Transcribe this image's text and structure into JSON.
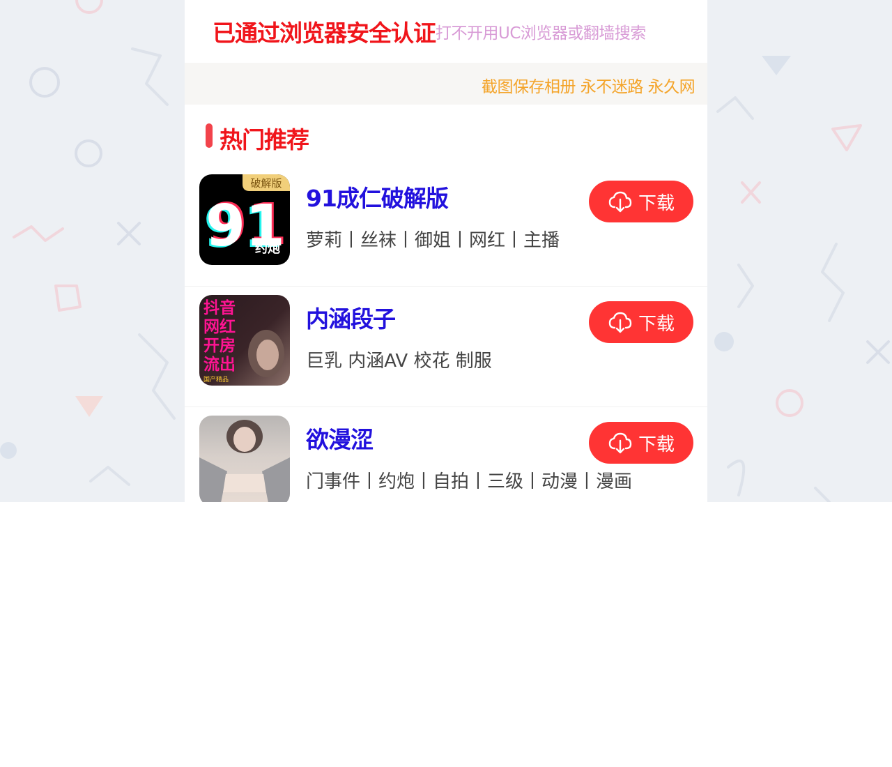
{
  "banner": {
    "main": "已通过浏览器安全认证",
    "sub": "打不开用UC浏览器或翻墙搜索"
  },
  "notice": {
    "text": "截图保存相册 永不迷路 永久网"
  },
  "section": {
    "title": "热门推荐"
  },
  "apps": [
    {
      "name": "91成仁破解版",
      "tags": "萝莉丨丝袜丨御姐丨网红丨主播",
      "download_label": "下载",
      "icon": {
        "badge": "破解版",
        "number": "91",
        "caption": "约炮"
      }
    },
    {
      "name": "内涵段子",
      "tags": "巨乳 内涵AV 校花 制服",
      "download_label": "下载",
      "icon": {
        "lines": [
          "抖音",
          "网红",
          "开房",
          "流出"
        ],
        "caption": "国产精品"
      }
    },
    {
      "name": "欲漫涩",
      "tags": "门事件丨约炮丨自拍丨三级丨动漫丨漫画",
      "download_label": "下载",
      "icon": {}
    }
  ],
  "colors": {
    "accent_red": "#ff3434",
    "title_red": "#f0151b",
    "app_name_blue": "#2211dd",
    "notice_orange": "#f4a42a",
    "banner_sub_pink": "#d89bd6",
    "background_gray": "#edf0f4"
  },
  "icons": {
    "download": "cloud-download-icon"
  }
}
